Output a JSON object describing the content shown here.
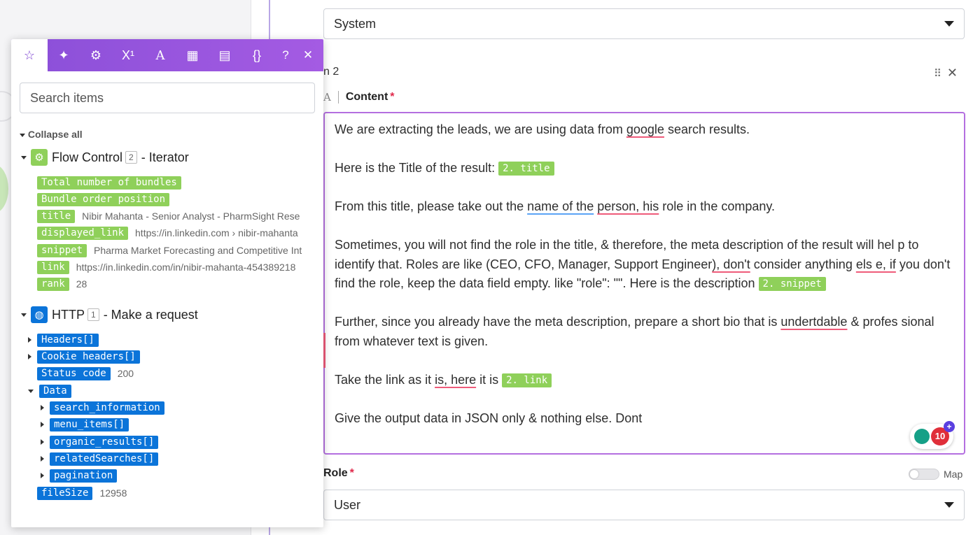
{
  "top_select": {
    "value": "System"
  },
  "item": {
    "label_fragment": "n 2",
    "drag_icon": "drag-handle-icon",
    "close_icon": "close-icon"
  },
  "content_field": {
    "label": "Content",
    "required_mark": "*",
    "lines": {
      "l1a": "We are extracting the leads, we are using data from ",
      "l1b": "google",
      "l1c": " search results.",
      "l2a": "Here is the Title of the result: ",
      "l2pill": "2. title",
      "l3a": "From this title, please take out the ",
      "l3b": "name of the",
      "l3c": " ",
      "l3d": "person, his",
      "l3e": " role in the company.",
      "l4a": "Sometimes, you will not find the role in the title, & therefore, the meta description of the result will hel p to identify that. Roles are like (CEO, CFO, Manager, Support Engineer",
      "l4b": "), don't",
      "l4c": " consider anything ",
      "l4d": "els e, if",
      "l4e": " you don't find the role, keep the data field empty. like \"role\": \"\". Here is the description ",
      "l4pill": "2. snippet",
      "l5a": "Further, since you already have the meta description, prepare a short bio that is ",
      "l5b": "undertdable",
      "l5c": " & profes sional from whatever text is given.",
      "l6a": "Take the link as it ",
      "l6b": "is, here",
      "l6c": " it is ",
      "l6pill": "2. link",
      "l7a": "Give the output data in JSON only & nothing else. Dont"
    }
  },
  "grammar_widget": {
    "count": "10",
    "plus": "+"
  },
  "role_field": {
    "label": "Role",
    "required_mark": "*",
    "map_label": "Map",
    "value": "User"
  },
  "panel": {
    "tabs": [
      "star-icon",
      "sparkle-icon",
      "gear-icon",
      "superscript-icon",
      "text-icon",
      "calendar-icon",
      "table-icon",
      "braces-icon"
    ],
    "help_icon": "question-icon",
    "close_icon": "close-icon",
    "search_placeholder": "Search items",
    "collapse_all": "Collapse all",
    "modules": [
      {
        "name": "Flow Control",
        "badge": "2",
        "suffix": "- Iterator",
        "color": "#8fd05a",
        "items": [
          {
            "key": "Total number of bundles",
            "value": ""
          },
          {
            "key": "Bundle order position",
            "value": ""
          },
          {
            "key": "title",
            "value": "Nibir Mahanta - Senior Analyst - PharmSight Rese"
          },
          {
            "key": "displayed_link",
            "value": "https://in.linkedin.com › nibir-mahanta"
          },
          {
            "key": "snippet",
            "value": "Pharma Market Forecasting and Competitive Int"
          },
          {
            "key": "link",
            "value": "https://in.linkedin.com/in/nibir-mahanta-454389218"
          },
          {
            "key": "rank",
            "value": "28"
          }
        ]
      },
      {
        "name": "HTTP",
        "badge": "1",
        "suffix": "- Make a request",
        "color": "#0b74d9",
        "items": [
          {
            "key": "Headers[]",
            "value": ""
          },
          {
            "key": "Cookie headers[]",
            "value": ""
          },
          {
            "key": "Status code",
            "value": "200"
          },
          {
            "key": "Data",
            "value": ""
          },
          {
            "key": "search_information",
            "value": ""
          },
          {
            "key": "menu_items[]",
            "value": ""
          },
          {
            "key": "organic_results[]",
            "value": ""
          },
          {
            "key": "relatedSearches[]",
            "value": ""
          },
          {
            "key": "pagination",
            "value": ""
          },
          {
            "key": "fileSize",
            "value": "12958"
          }
        ]
      }
    ]
  }
}
